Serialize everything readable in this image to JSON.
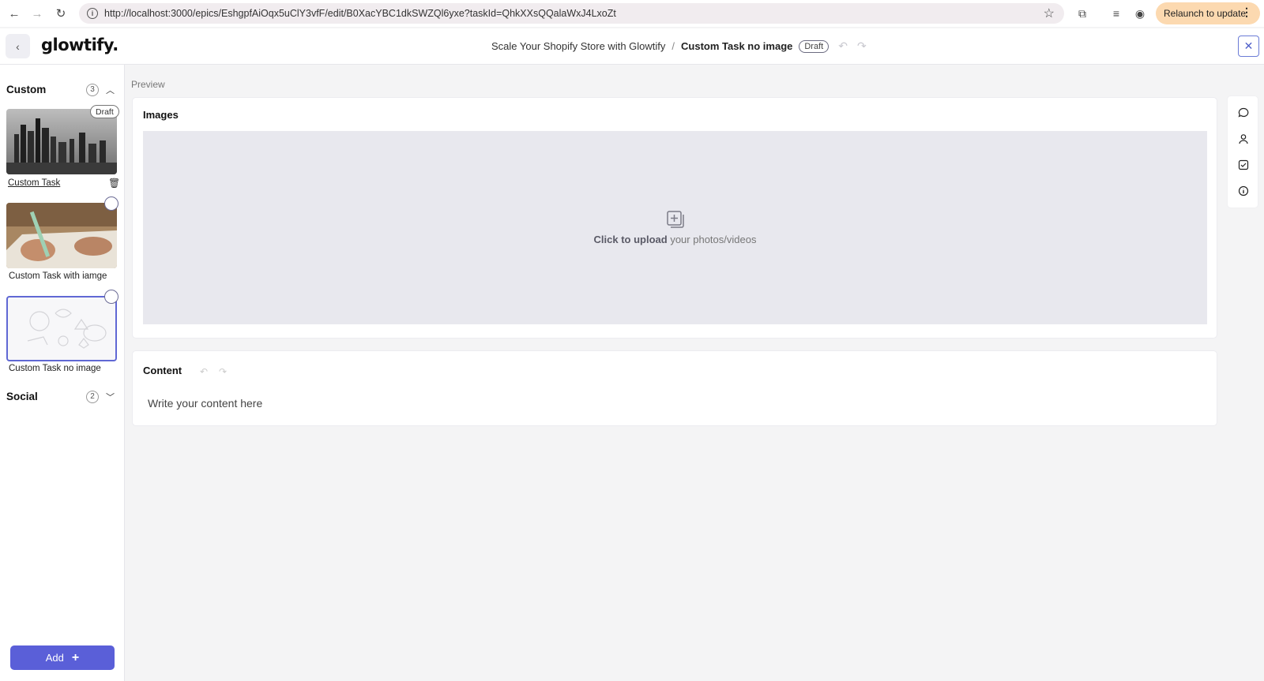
{
  "browser": {
    "url": "http://localhost:3000/epics/EshgpfAiOqx5uClY3vfF/edit/B0XacYBC1dkSWZQl6yxe?taskId=QhkXXsQQalaWxJ4LxoZt",
    "relaunch_label": "Relaunch to update"
  },
  "header": {
    "logo": "glowtify.",
    "breadcrumb_parent": "Scale Your Shopify Store with Glowtify",
    "breadcrumb_sep": "/",
    "breadcrumb_current": "Custom Task no image",
    "status": "Draft"
  },
  "sidebar": {
    "groups": [
      {
        "name": "Custom",
        "count": "3"
      },
      {
        "name": "Social",
        "count": "2"
      }
    ],
    "tasks": [
      {
        "label": "Custom Task",
        "badge": "Draft"
      },
      {
        "label": "Custom Task with iamge"
      },
      {
        "label": "Custom Task no image"
      }
    ],
    "add_label": "Add"
  },
  "main": {
    "preview_label": "Preview",
    "images_title": "Images",
    "upload_strong": "Click to upload",
    "upload_rest": " your photos/videos",
    "content_title": "Content",
    "content_placeholder": "Write your content here"
  },
  "icons": [
    "back-icon",
    "comment-icon",
    "user-icon",
    "checkbox-icon",
    "info-icon",
    "trash-icon",
    "close-icon",
    "upload-image-icon"
  ]
}
